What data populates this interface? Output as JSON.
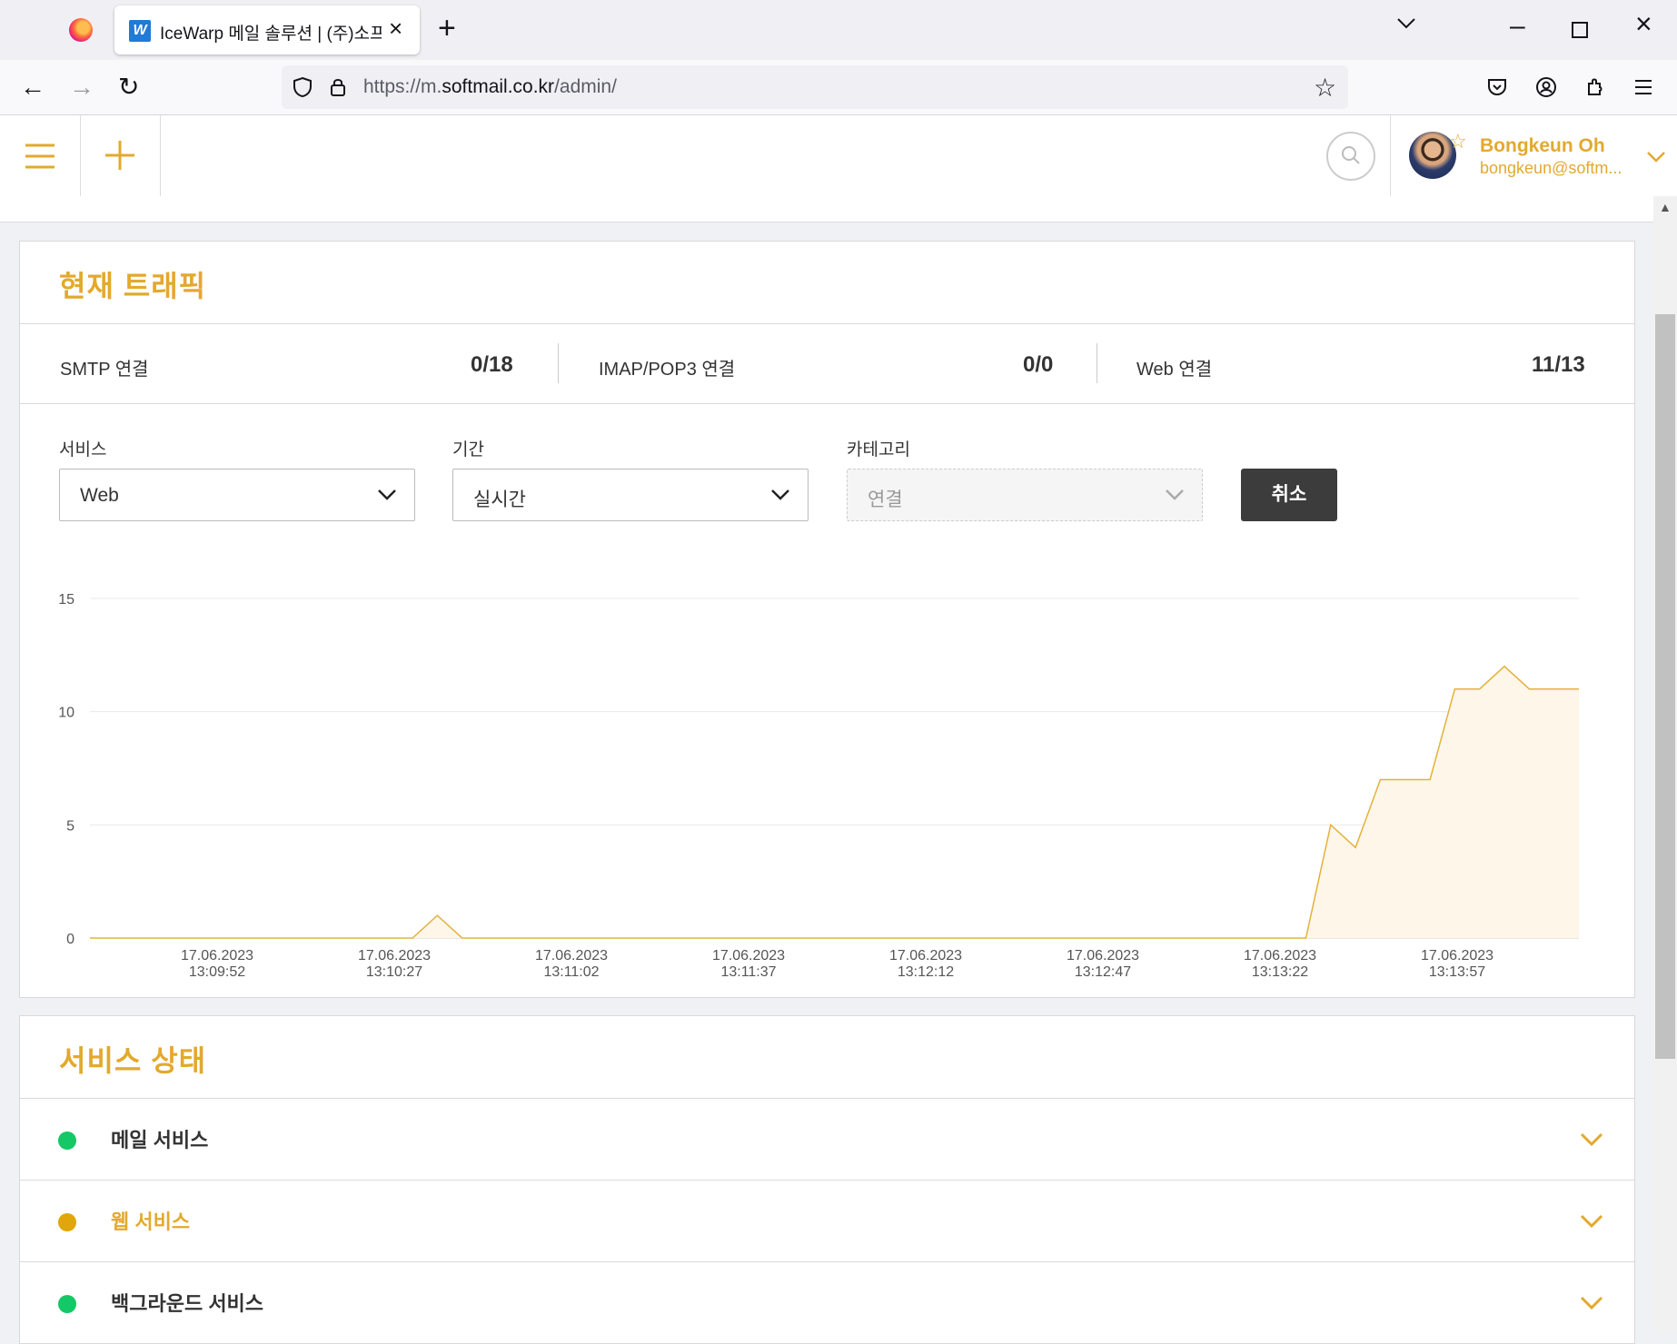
{
  "browser": {
    "tab_title": "IceWarp 메일 솔루션 | (주)소프",
    "tab_favicon": "W",
    "url_prefix": "https://m.",
    "url_host": "softmail.co.kr",
    "url_path": "/admin/"
  },
  "header": {
    "user_name": "Bongkeun Oh",
    "user_email": "bongkeun@softm..."
  },
  "traffic": {
    "title": "현재 트래픽",
    "stats": [
      {
        "label": "SMTP 연결",
        "value": "0/18"
      },
      {
        "label": "IMAP/POP3 연결",
        "value": "0/0"
      },
      {
        "label": "Web 연결",
        "value": "11/13"
      }
    ],
    "filters": {
      "service_label": "서비스",
      "service_value": "Web",
      "period_label": "기간",
      "period_value": "실시간",
      "category_label": "카테고리",
      "category_value": "연결",
      "cancel_label": "취소"
    }
  },
  "chart_data": {
    "type": "area",
    "ylim": [
      0,
      15
    ],
    "yticks": [
      "0",
      "5",
      "10",
      "15"
    ],
    "xticks": [
      {
        "date": "17.06.2023",
        "time": "13:09:52"
      },
      {
        "date": "17.06.2023",
        "time": "13:10:27"
      },
      {
        "date": "17.06.2023",
        "time": "13:11:02"
      },
      {
        "date": "17.06.2023",
        "time": "13:11:37"
      },
      {
        "date": "17.06.2023",
        "time": "13:12:12"
      },
      {
        "date": "17.06.2023",
        "time": "13:12:47"
      },
      {
        "date": "17.06.2023",
        "time": "13:13:22"
      },
      {
        "date": "17.06.2023",
        "time": "13:13:57"
      }
    ],
    "x": [
      0,
      5,
      10,
      15,
      20,
      25,
      30,
      35,
      40,
      45,
      50,
      55,
      60,
      65,
      70,
      75,
      80,
      85,
      90,
      95,
      100,
      105,
      110,
      115,
      120,
      125,
      130,
      135,
      140,
      145,
      150,
      155,
      160,
      165,
      170,
      175,
      180,
      185,
      190,
      195,
      200,
      205,
      210,
      215,
      220,
      225,
      230,
      235,
      240,
      245,
      250,
      255,
      260,
      265,
      270,
      275,
      280,
      285,
      290,
      295,
      300
    ],
    "values": [
      0,
      0,
      0,
      0,
      0,
      0,
      0,
      0,
      0,
      0,
      0,
      0,
      0,
      0,
      1,
      0,
      0,
      0,
      0,
      0,
      0,
      0,
      0,
      0,
      0,
      0,
      0,
      0,
      0,
      0,
      0,
      0,
      0,
      0,
      0,
      0,
      0,
      0,
      0,
      0,
      0,
      0,
      0,
      0,
      0,
      0,
      0,
      0,
      0,
      0,
      5,
      4,
      7,
      7,
      7,
      11,
      11,
      12,
      11,
      11,
      11,
      11
    ],
    "color": "#e3b23c",
    "fill": "#fdf6e9"
  },
  "services": {
    "title": "서비스 상태",
    "items": [
      {
        "name": "메일 서비스",
        "status_color": "#13c866",
        "name_color": "#333333"
      },
      {
        "name": "웹 서비스",
        "status_color": "#e0a60a",
        "name_color": "#e3a92e"
      },
      {
        "name": "백그라운드 서비스",
        "status_color": "#13c866",
        "name_color": "#333333"
      }
    ]
  },
  "colors": {
    "accent": "#e3a92e"
  }
}
